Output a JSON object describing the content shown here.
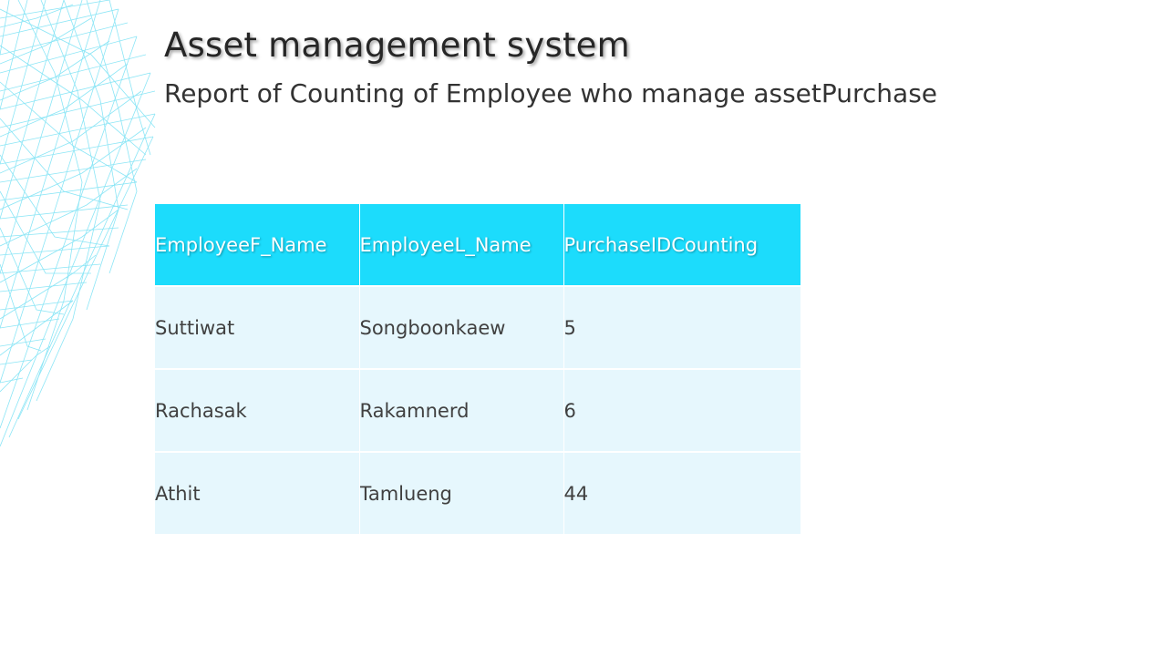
{
  "header": {
    "title": "Asset management system",
    "subtitle": "Report of Counting of Employee who manage assetPurchase"
  },
  "table": {
    "columns": [
      "EmployeeF_Name",
      "EmployeeL_Name",
      "PurchaseIDCounting"
    ],
    "rows": [
      [
        "Suttiwat",
        "Songboonkaew",
        "5"
      ],
      [
        "Rachasak",
        "Rakamnerd",
        "6"
      ],
      [
        "Athit",
        "Tamlueng",
        "44"
      ]
    ]
  },
  "colors": {
    "header_fill": "#1cdcfc",
    "row_fill": "#e6f7fd",
    "decor_lines": "#7fe3f5"
  },
  "decor_icon": "wireframe-lines-graphic"
}
